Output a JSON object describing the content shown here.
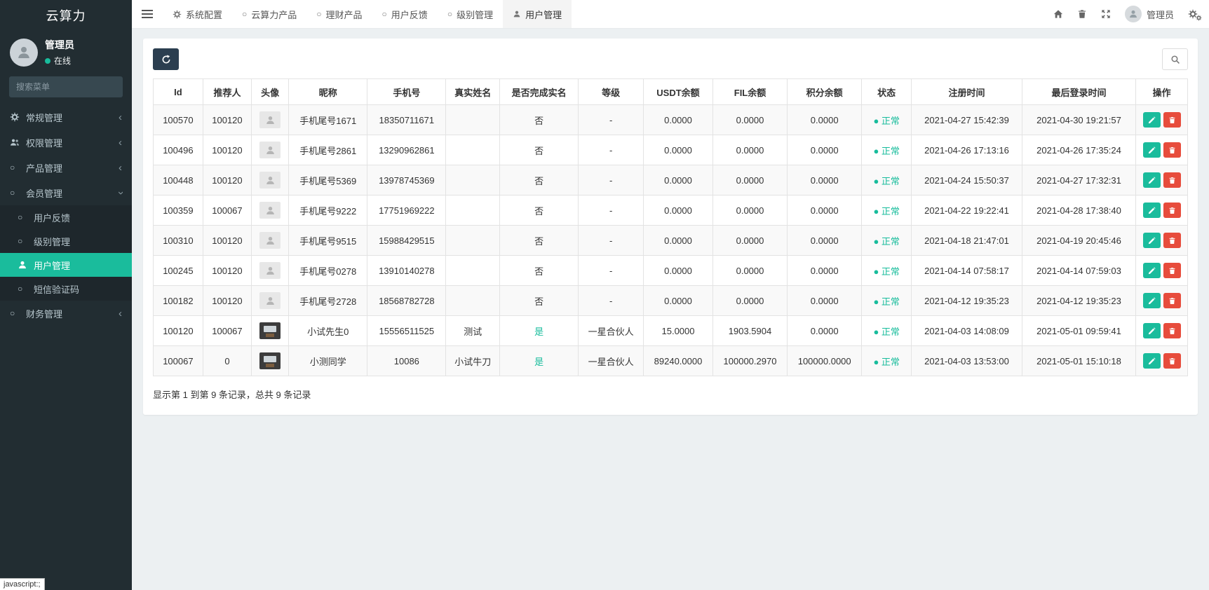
{
  "app": {
    "title": "云算力"
  },
  "colors": {
    "accent": "#1abc9c",
    "danger": "#e74c3c",
    "status_green": "#18bc9c",
    "sidebar_bg": "#222d32"
  },
  "icons": {
    "dot": "●",
    "circle": "○",
    "chevron": "‹"
  },
  "sidebar": {
    "user": {
      "name": "管理员",
      "status": "在线"
    },
    "search_placeholder": "搜索菜单",
    "items": [
      {
        "label": "常规管理",
        "icon": "cogs-icon"
      },
      {
        "label": "权限管理",
        "icon": "users-icon"
      },
      {
        "label": "产品管理",
        "icon": "circle-icon"
      },
      {
        "label": "会员管理",
        "icon": "circle-icon",
        "expanded": true,
        "children": [
          {
            "label": "用户反馈"
          },
          {
            "label": "级别管理"
          },
          {
            "label": "用户管理",
            "active": true
          },
          {
            "label": "短信验证码"
          }
        ]
      },
      {
        "label": "财务管理",
        "icon": "circle-icon"
      }
    ]
  },
  "navbar": {
    "tabs": [
      {
        "label": "系统配置",
        "icon": "gear-icon"
      },
      {
        "label": "云算力产品",
        "icon": "circle-icon"
      },
      {
        "label": "理财产品",
        "icon": "circle-icon"
      },
      {
        "label": "用户反馈",
        "icon": "circle-icon"
      },
      {
        "label": "级别管理",
        "icon": "circle-icon"
      },
      {
        "label": "用户管理",
        "icon": "user-icon",
        "active": true
      }
    ],
    "user_label": "管理员"
  },
  "table": {
    "headers": [
      "Id",
      "推荐人",
      "头像",
      "昵称",
      "手机号",
      "真实姓名",
      "是否完成实名",
      "等级",
      "USDT余额",
      "FIL余额",
      "积分余额",
      "状态",
      "注册时间",
      "最后登录时间",
      "操作"
    ],
    "rows": [
      {
        "id": "100570",
        "referrer": "100120",
        "avatar": "placeholder",
        "nickname": "手机尾号1671",
        "phone": "18350711671",
        "real_name": "",
        "verified": "否",
        "verified_ok": false,
        "level": "-",
        "usdt": "0.0000",
        "fil": "0.0000",
        "points": "0.0000",
        "status": "正常",
        "registered_at": "2021-04-27 15:42:39",
        "last_login_at": "2021-04-30 19:21:57"
      },
      {
        "id": "100496",
        "referrer": "100120",
        "avatar": "placeholder",
        "nickname": "手机尾号2861",
        "phone": "13290962861",
        "real_name": "",
        "verified": "否",
        "verified_ok": false,
        "level": "-",
        "usdt": "0.0000",
        "fil": "0.0000",
        "points": "0.0000",
        "status": "正常",
        "registered_at": "2021-04-26 17:13:16",
        "last_login_at": "2021-04-26 17:35:24"
      },
      {
        "id": "100448",
        "referrer": "100120",
        "avatar": "placeholder",
        "nickname": "手机尾号5369",
        "phone": "13978745369",
        "real_name": "",
        "verified": "否",
        "verified_ok": false,
        "level": "-",
        "usdt": "0.0000",
        "fil": "0.0000",
        "points": "0.0000",
        "status": "正常",
        "registered_at": "2021-04-24 15:50:37",
        "last_login_at": "2021-04-27 17:32:31"
      },
      {
        "id": "100359",
        "referrer": "100067",
        "avatar": "placeholder",
        "nickname": "手机尾号9222",
        "phone": "17751969222",
        "real_name": "",
        "verified": "否",
        "verified_ok": false,
        "level": "-",
        "usdt": "0.0000",
        "fil": "0.0000",
        "points": "0.0000",
        "status": "正常",
        "registered_at": "2021-04-22 19:22:41",
        "last_login_at": "2021-04-28 17:38:40"
      },
      {
        "id": "100310",
        "referrer": "100120",
        "avatar": "placeholder",
        "nickname": "手机尾号9515",
        "phone": "15988429515",
        "real_name": "",
        "verified": "否",
        "verified_ok": false,
        "level": "-",
        "usdt": "0.0000",
        "fil": "0.0000",
        "points": "0.0000",
        "status": "正常",
        "registered_at": "2021-04-18 21:47:01",
        "last_login_at": "2021-04-19 20:45:46"
      },
      {
        "id": "100245",
        "referrer": "100120",
        "avatar": "placeholder",
        "nickname": "手机尾号0278",
        "phone": "13910140278",
        "real_name": "",
        "verified": "否",
        "verified_ok": false,
        "level": "-",
        "usdt": "0.0000",
        "fil": "0.0000",
        "points": "0.0000",
        "status": "正常",
        "registered_at": "2021-04-14 07:58:17",
        "last_login_at": "2021-04-14 07:59:03"
      },
      {
        "id": "100182",
        "referrer": "100120",
        "avatar": "placeholder",
        "nickname": "手机尾号2728",
        "phone": "18568782728",
        "real_name": "",
        "verified": "否",
        "verified_ok": false,
        "level": "-",
        "usdt": "0.0000",
        "fil": "0.0000",
        "points": "0.0000",
        "status": "正常",
        "registered_at": "2021-04-12 19:35:23",
        "last_login_at": "2021-04-12 19:35:23"
      },
      {
        "id": "100120",
        "referrer": "100067",
        "avatar": "photo",
        "nickname": "小试先生0",
        "phone": "15556511525",
        "real_name": "测试",
        "verified": "是",
        "verified_ok": true,
        "level": "一星合伙人",
        "usdt": "15.0000",
        "fil": "1903.5904",
        "points": "0.0000",
        "status": "正常",
        "registered_at": "2021-04-03 14:08:09",
        "last_login_at": "2021-05-01 09:59:41"
      },
      {
        "id": "100067",
        "referrer": "0",
        "avatar": "photo",
        "nickname": "小测同学",
        "phone": "10086",
        "real_name": "小试牛刀",
        "verified": "是",
        "verified_ok": true,
        "level": "一星合伙人",
        "usdt": "89240.0000",
        "fil": "100000.2970",
        "points": "100000.0000",
        "status": "正常",
        "registered_at": "2021-04-03 13:53:00",
        "last_login_at": "2021-05-01 15:10:18"
      }
    ],
    "summary": "显示第 1 到第 9 条记录，总共 9 条记录"
  },
  "statusbar": {
    "hint": "javascript:;"
  }
}
